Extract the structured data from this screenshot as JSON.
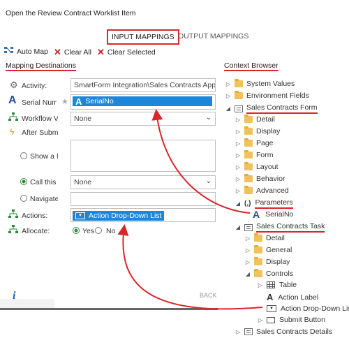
{
  "window": {
    "title": "Open the Review Contract Worklist Item"
  },
  "tabs": {
    "input": "INPUT MAPPINGS",
    "output": "OUTPUT MAPPINGS"
  },
  "toolbar": {
    "auto_map": "Auto Map",
    "clear_all": "Clear All",
    "clear_selected": "Clear Selected"
  },
  "mapping": {
    "title": "Mapping Destinations",
    "activity_label": "Activity:",
    "activity_value": "SmartForm Integration\\Sales Contracts Approva",
    "serial_label": "Serial Numb",
    "serial_value": "SerialNo",
    "workflow_label": "Workflow Vi",
    "workflow_value": "None",
    "after_submit_label": "After Submi",
    "show_label": "Show a M",
    "call_label": "Call this I",
    "call_value": "None",
    "navigate_label": "Navigate",
    "actions_label": "Actions:",
    "actions_value": "Action Drop-Down List",
    "allocate_label": "Allocate:",
    "yes": "Yes",
    "no": "No",
    "back": "BACK",
    "info": "i"
  },
  "context": {
    "title": "Context Browser",
    "system_values": "System Values",
    "environment_fields": "Environment Fields",
    "sales_form": "Sales Contracts Form",
    "form_children": [
      "Detail",
      "Display",
      "Page",
      "Form",
      "Layout",
      "Behavior",
      "Advanced"
    ],
    "parameters": "Parameters",
    "serialno": "SerialNo",
    "sales_task": "Sales Contracts Task",
    "task_children": [
      "Detail",
      "General",
      "Display"
    ],
    "controls": "Controls",
    "control_items": [
      "Table",
      "Action Label",
      "Action Drop-Down List",
      "Submit Button"
    ],
    "sales_details": "Sales Contracts Details"
  },
  "colors": {
    "accent_red": "#d9262b",
    "chip_blue": "#1e86d8",
    "folder": "#f1c15c",
    "radio_green": "#2a8a3a"
  }
}
